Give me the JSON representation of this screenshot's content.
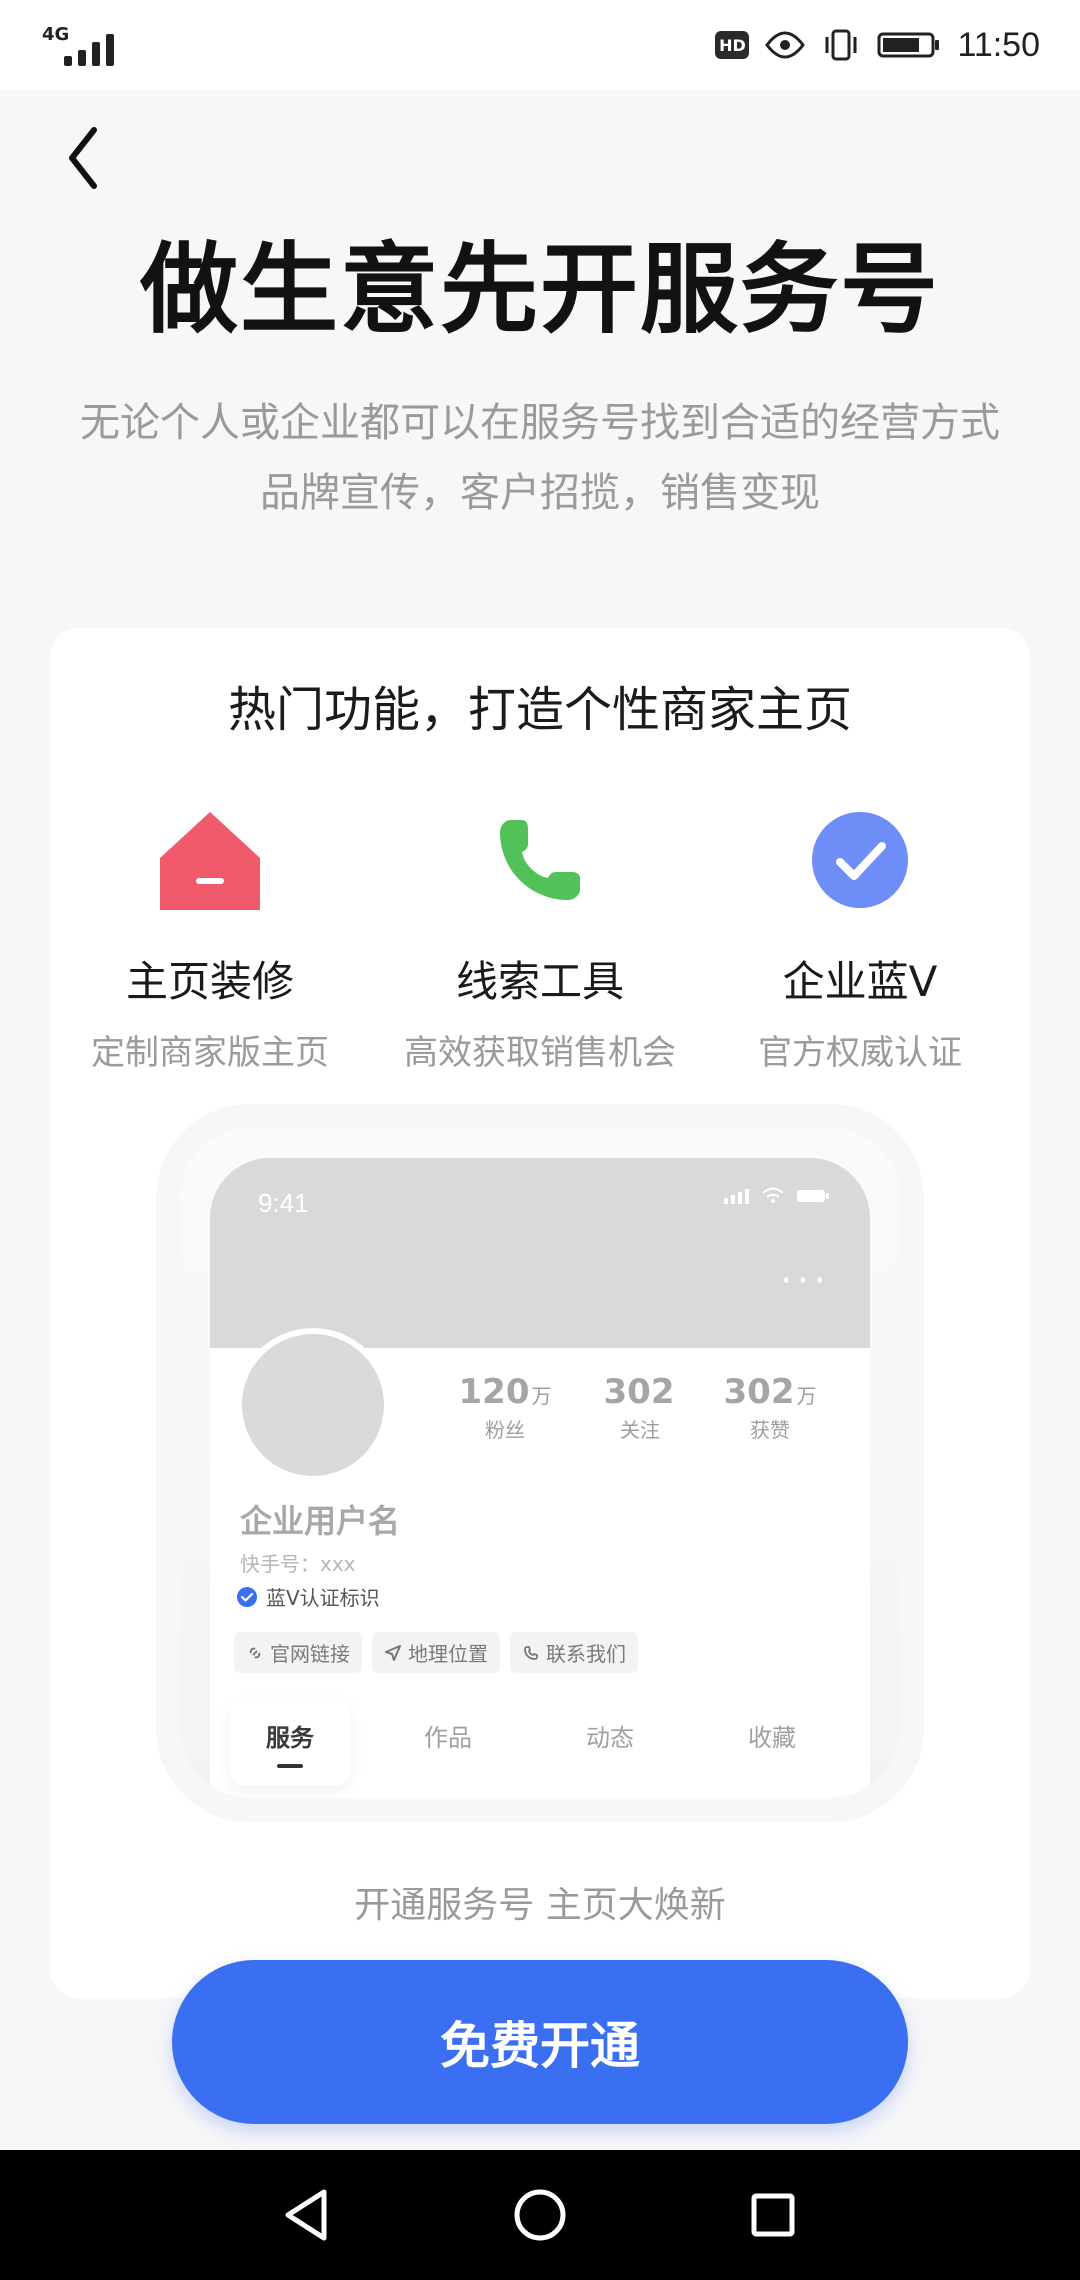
{
  "status_bar": {
    "network": "4G",
    "hd": "HD",
    "time": "11:50"
  },
  "header": {
    "title": "做生意先开服务号",
    "subtitle_lines": [
      "无论个人或企业都可以在服务号找到合适的经营方式",
      "品牌宣传，客户招揽，销售变现"
    ]
  },
  "card": {
    "title": "热门功能，打造个性商家主页",
    "features": [
      {
        "label": "主页装修",
        "desc": "定制商家版主页",
        "icon": "home-icon",
        "color": "#F05A6A"
      },
      {
        "label": "线索工具",
        "desc": "高效获取销售机会",
        "icon": "phone-icon",
        "color": "#52C15A"
      },
      {
        "label": "企业蓝V",
        "desc": "官方权威认证",
        "icon": "check-circle-icon",
        "color": "#6E8DF6"
      }
    ],
    "mockup": {
      "time": "9:41",
      "more": "···",
      "stats": [
        {
          "num": "120",
          "unit": "万",
          "cap": "粉丝"
        },
        {
          "num": "302",
          "unit": "",
          "cap": "关注"
        },
        {
          "num": "302",
          "unit": "万",
          "cap": "获赞"
        }
      ],
      "name": "企业用户名",
      "id_text": "快手号：xxx",
      "verified_text": "蓝V认证标识",
      "chips": [
        {
          "icon": "link-icon",
          "text": "官网链接"
        },
        {
          "icon": "location-icon",
          "text": "地理位置"
        },
        {
          "icon": "phone-small-icon",
          "text": "联系我们"
        }
      ],
      "tabs": [
        "服务",
        "作品",
        "动态",
        "收藏"
      ]
    },
    "caption": "开通服务号 主页大焕新"
  },
  "cta": {
    "label": "免费开通"
  },
  "colors": {
    "primary": "#3B6FF2"
  }
}
